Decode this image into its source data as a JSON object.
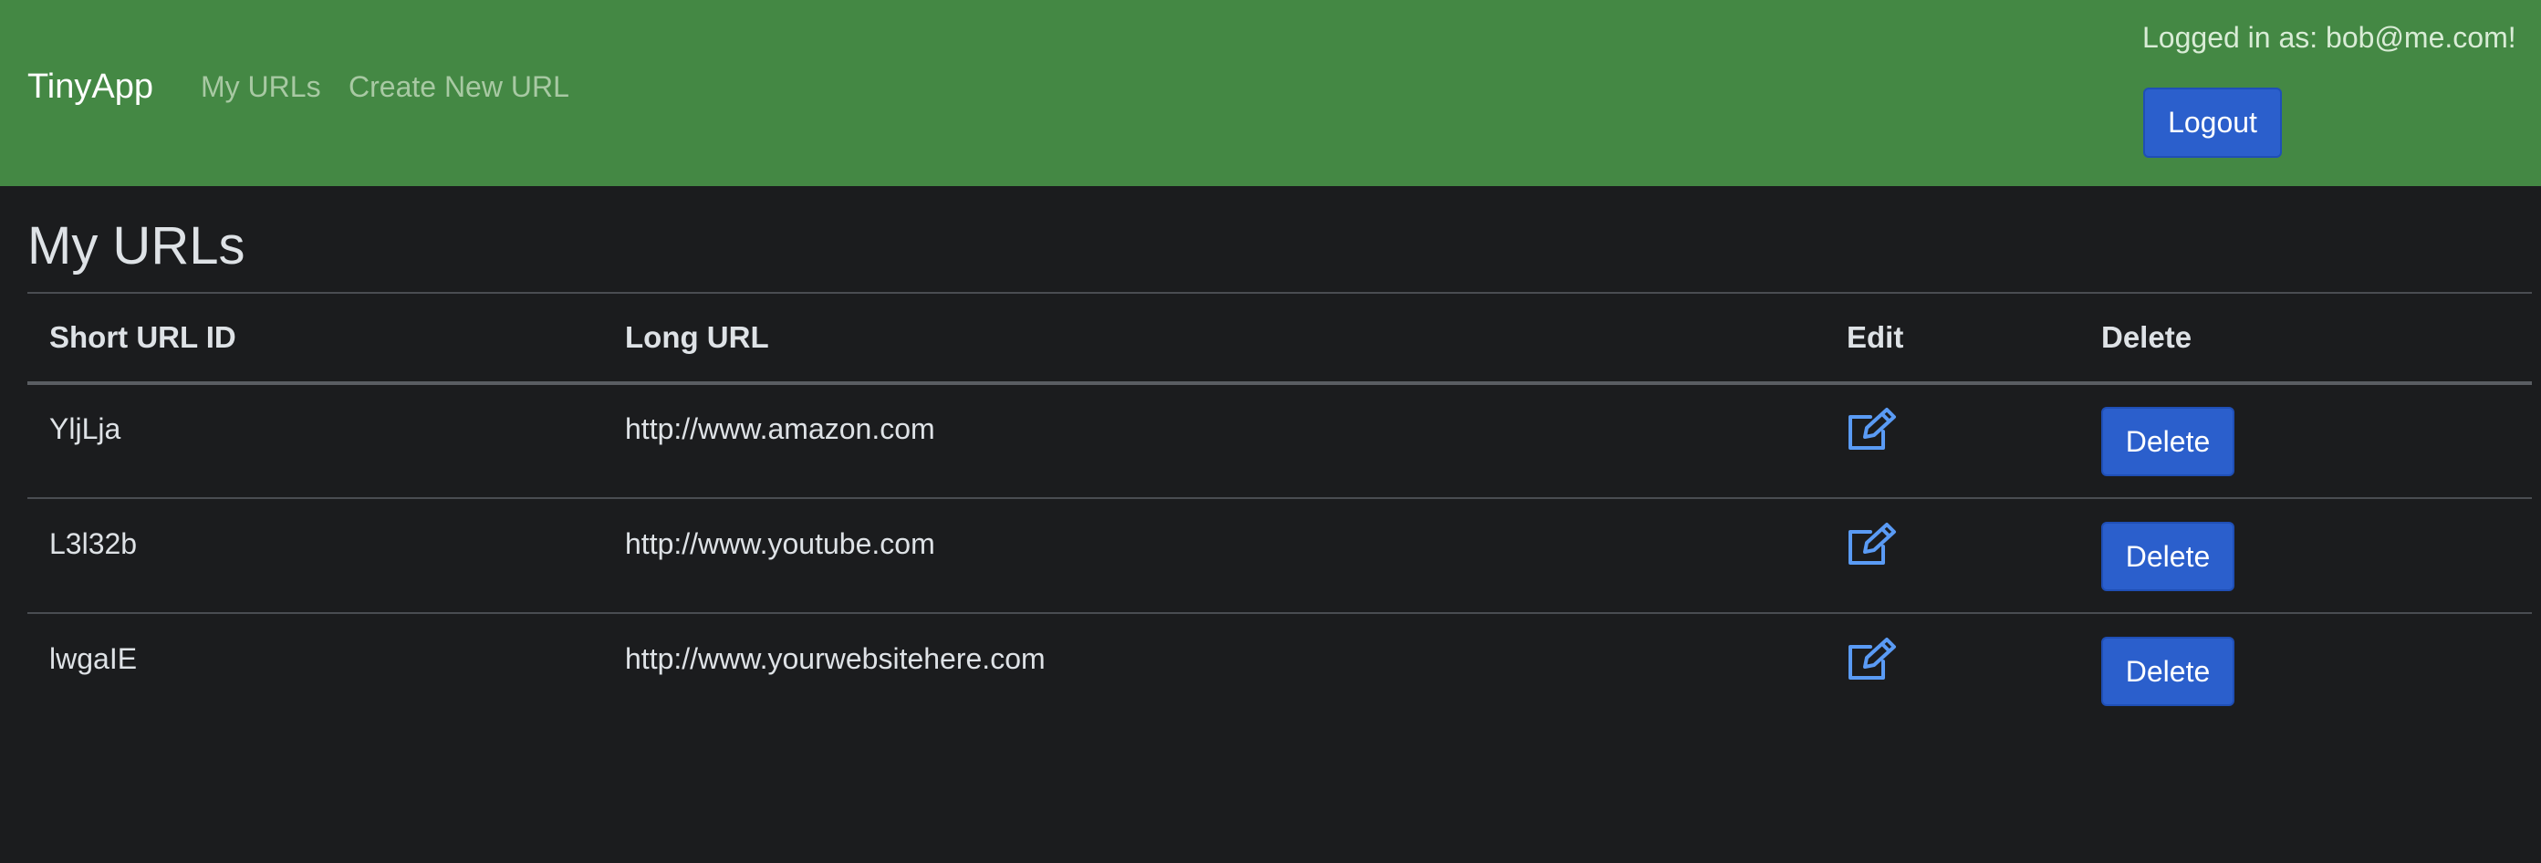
{
  "navbar": {
    "brand": "TinyApp",
    "links": [
      {
        "label": "My URLs"
      },
      {
        "label": "Create New URL"
      }
    ],
    "login_text": "Logged in as: bob@me.com!",
    "logout_label": "Logout",
    "background_color": "#448844"
  },
  "main": {
    "title": "My URLs",
    "table": {
      "headers": [
        "Short URL ID",
        "Long URL",
        "Edit",
        "Delete"
      ],
      "rows": [
        {
          "short_id": "YljLja",
          "long_url": "http://www.amazon.com",
          "edit_icon": "edit-icon",
          "delete_label": "Delete"
        },
        {
          "short_id": "L3l32b",
          "long_url": "http://www.youtube.com",
          "edit_icon": "edit-icon",
          "delete_label": "Delete"
        },
        {
          "short_id": "lwgaIE",
          "long_url": "http://www.yourwebsitehere.com",
          "edit_icon": "edit-icon",
          "delete_label": "Delete"
        }
      ]
    }
  },
  "colors": {
    "page_background": "#1b1c1e",
    "button_primary": "#2b5fcc",
    "edit_icon": "#5a9bf5"
  }
}
